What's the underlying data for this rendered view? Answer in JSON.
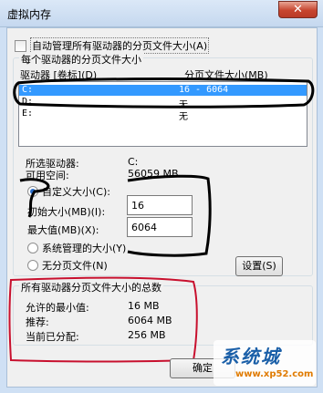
{
  "window": {
    "title": "虚拟内存",
    "close_glyph": "✕"
  },
  "auto_manage": {
    "label": "自动管理所有驱动器的分页文件大小(A)",
    "checked": false
  },
  "group_drives": {
    "label": "每个驱动器的分页文件大小",
    "col_drive": "驱动器 [卷标](D)",
    "col_size": "分页文件大小(MB)",
    "rows": [
      {
        "drive": "C:",
        "size": "16 - 6064"
      },
      {
        "drive": "D:",
        "size": "无"
      },
      {
        "drive": "E:",
        "size": "无"
      }
    ]
  },
  "selected": {
    "drive_label": "所选驱动器:",
    "drive_value": "C:",
    "space_label": "可用空间:",
    "space_value": "56059 MB"
  },
  "options": {
    "custom_label": "自定义大小(C):",
    "initial_label": "初始大小(MB)(I):",
    "initial_value": "16",
    "max_label": "最大值(MB)(X):",
    "max_value": "6064",
    "system_label": "系统管理的大小(Y)",
    "none_label": "无分页文件(N)",
    "set_button": "设置(S)"
  },
  "totals": {
    "label": "所有驱动器分页文件大小的总数",
    "min_label": "允许的最小值:",
    "min_value": "16 MB",
    "rec_label": "推荐:",
    "rec_value": "6064 MB",
    "cur_label": "当前已分配:",
    "cur_value": "256 MB"
  },
  "footer": {
    "ok_button": "确定"
  },
  "watermark": {
    "text": "系统城",
    "url": "www.xp52.com"
  },
  "colors": {
    "selection": "#3399ff",
    "annotation_black": "#000000",
    "annotation_red": "#c8102e"
  }
}
